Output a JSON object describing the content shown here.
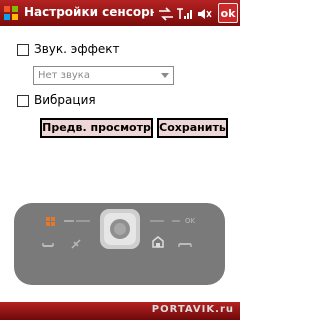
{
  "title_bar": {
    "title": "Настройки сенсорны",
    "ok_label": "ok",
    "icons": [
      "windows-start-icon",
      "connectivity-icon",
      "signal-icon",
      "volume-icon"
    ]
  },
  "settings": {
    "sound_effect_label": "Звук. эффект",
    "sound_effect_checked": false,
    "sound_select_value": "Нет звука",
    "vibration_label": "Вибрация",
    "vibration_checked": false
  },
  "buttons": {
    "preview_label": "Предв. просмотр",
    "save_label": "Сохранить"
  },
  "device_preview": {
    "body_color": "#7a7a7a",
    "accent_color": "#e07a2a",
    "keys": [
      "windows-key",
      "home-key",
      "ok-key",
      "call-key",
      "end-key",
      "dpad"
    ]
  },
  "watermark": {
    "brand": "PORTAVIK.ru"
  }
}
